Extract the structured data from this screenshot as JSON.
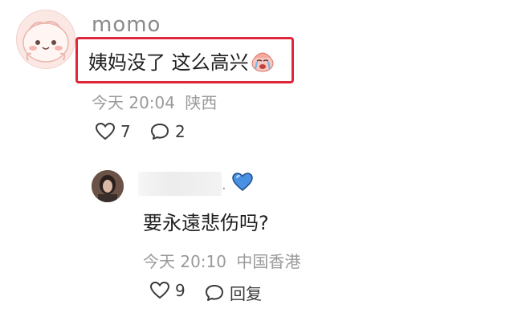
{
  "top_comment": {
    "username": "momo",
    "text": "姨妈没了 这么高兴",
    "emoji_icon": "crying-face-icon",
    "time": "今天 20:04",
    "location": "陕西",
    "likes": "7",
    "replies": "2"
  },
  "reply": {
    "badge_icon": "blue-heart-icon",
    "text": "要永遠悲伤吗?",
    "time": "今天 20:10",
    "location": "中国香港",
    "likes": "9",
    "reply_label": "回复"
  },
  "colors": {
    "highlight_border": "#e0263a",
    "badge_blue": "#4a90e2"
  }
}
